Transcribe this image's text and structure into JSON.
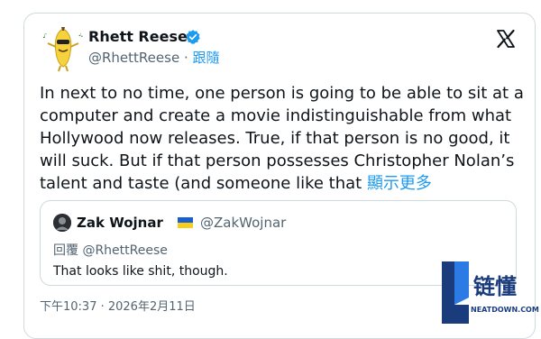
{
  "author": {
    "name": "Rhett Reese",
    "handle": "@RhettReese",
    "separator": " · ",
    "follow_label": "跟隨",
    "avatar_icon": "banana-character-avatar",
    "verified_icon": "verified-badge-icon"
  },
  "tweet": {
    "text": "In next to no time, one person is going to be able to sit at a computer and create a movie indistinguishable from what Hollywood now releases.  True, if that person is no good, it will suck.  But if that person possesses Christopher Nolan’s talent and taste (and someone like that ",
    "show_more": "顯示更多"
  },
  "quote": {
    "name": "Zak Wojnar",
    "flag_icon": "ukraine-flag-icon",
    "handle": "@ZakWojnar",
    "reply_to": "回覆 @RhettReese",
    "text": "That looks like shit, though."
  },
  "timestamp": "下午10:37 · 2026年2月11日",
  "watermark": {
    "brand": "链懂",
    "url": "NEATDOWN.COM"
  },
  "colors": {
    "accent": "#1d9bf0",
    "text": "#0f1419",
    "muted": "#536471",
    "border": "#cfd9de"
  }
}
